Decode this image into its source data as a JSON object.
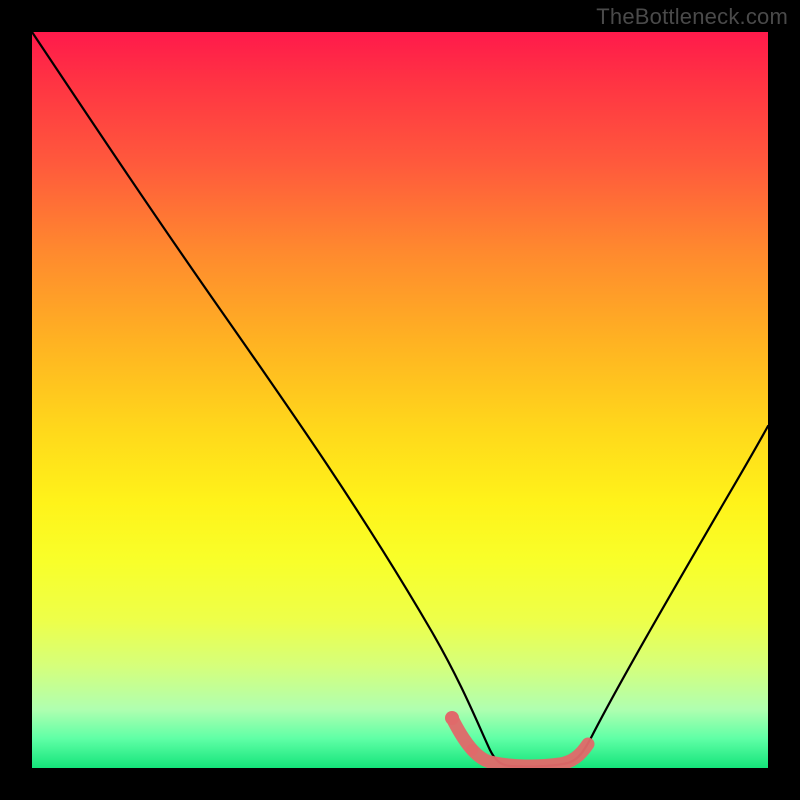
{
  "watermark": "TheBottleneck.com",
  "chart_data": {
    "type": "line",
    "title": "",
    "xlabel": "",
    "ylabel": "",
    "xlim": [
      0,
      1
    ],
    "ylim": [
      0,
      1
    ],
    "x": [
      0.0,
      0.05,
      0.1,
      0.15,
      0.2,
      0.25,
      0.3,
      0.35,
      0.4,
      0.45,
      0.5,
      0.55,
      0.58,
      0.6,
      0.63,
      0.68,
      0.72,
      0.75,
      0.8,
      0.85,
      0.9,
      0.95,
      1.0
    ],
    "values": [
      1.0,
      0.93,
      0.85,
      0.76,
      0.68,
      0.6,
      0.51,
      0.43,
      0.35,
      0.27,
      0.19,
      0.1,
      0.04,
      0.01,
      0.0,
      0.0,
      0.0,
      0.02,
      0.1,
      0.2,
      0.3,
      0.4,
      0.5
    ],
    "highlight_segment": {
      "x": [
        0.56,
        0.58,
        0.6,
        0.63,
        0.66,
        0.69,
        0.72,
        0.74
      ],
      "values": [
        0.045,
        0.022,
        0.01,
        0.004,
        0.004,
        0.006,
        0.015,
        0.03
      ]
    },
    "gradient_stops": [
      {
        "pos": 0.0,
        "color": "#ff1a4b"
      },
      {
        "pos": 0.3,
        "color": "#ff8a2e"
      },
      {
        "pos": 0.64,
        "color": "#fff31a"
      },
      {
        "pos": 0.92,
        "color": "#b0ffb0"
      },
      {
        "pos": 1.0,
        "color": "#14e47a"
      }
    ]
  }
}
